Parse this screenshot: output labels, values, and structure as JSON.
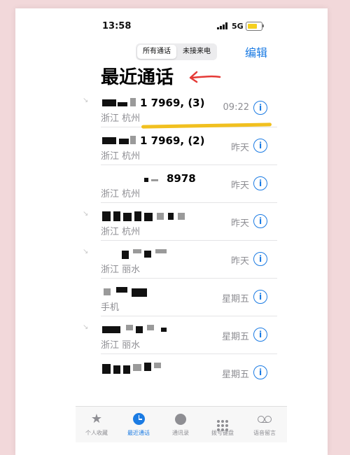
{
  "status": {
    "time": "13:58",
    "network": "5G"
  },
  "segmented": {
    "all": "所有通话",
    "missed": "未接来电"
  },
  "edit_label": "编辑",
  "title": "最近通话",
  "calls": [
    {
      "name": "1 7969, (3)",
      "location": "浙江 杭州",
      "time": "09:22"
    },
    {
      "name": "1 7969, (2)",
      "location": "浙江 杭州",
      "time": "昨天"
    },
    {
      "name": "8978",
      "location": "浙江 杭州",
      "time": "昨天"
    },
    {
      "name": "",
      "location": "浙江 杭州",
      "time": "昨天"
    },
    {
      "name": "",
      "location": "浙江 丽水",
      "time": "昨天"
    },
    {
      "name": "",
      "location": "手机",
      "time": "星期五"
    },
    {
      "name": "",
      "location": "浙江 丽水",
      "time": "星期五"
    },
    {
      "name": "",
      "location": "",
      "time": "星期五"
    }
  ],
  "info_glyph": "i",
  "tabs": [
    {
      "label": "个人收藏",
      "icon": "star-icon"
    },
    {
      "label": "最近通话",
      "icon": "clock-icon"
    },
    {
      "label": "通讯录",
      "icon": "person-icon"
    },
    {
      "label": "拨号键盘",
      "icon": "keypad-icon"
    },
    {
      "label": "语音留言",
      "icon": "voicemail-icon"
    }
  ],
  "colors": {
    "accent": "#1b7be3",
    "highlight": "#f1c01f",
    "arrow": "#e53935"
  }
}
